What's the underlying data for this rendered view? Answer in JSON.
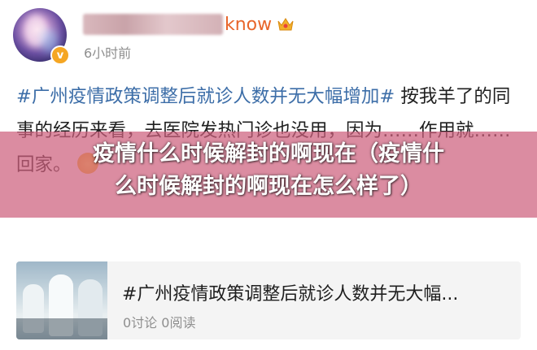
{
  "author": {
    "name_visible_suffix": "know",
    "time": "6小时前",
    "verified_badge": "v"
  },
  "post": {
    "hashtag": "#广州疫情政策调整后就诊人数并无大幅增加#",
    "body": " 按我羊了的同事的经历来看，去医院发热门诊也没用，因为……作用就……回家。"
  },
  "overlay": {
    "line1": "疫情什么时候解封的啊现在（疫情什",
    "line2": "么时候解封的啊现在怎么样了）"
  },
  "link_card": {
    "title": "#广州疫情政策调整后就诊人数并无大幅...",
    "stats": "0讨论 0阅读"
  },
  "colors": {
    "hashtag": "#3d6ea8",
    "name": "#e8652a",
    "banner": "#cd5f7d",
    "muted": "#8f8f8f"
  }
}
